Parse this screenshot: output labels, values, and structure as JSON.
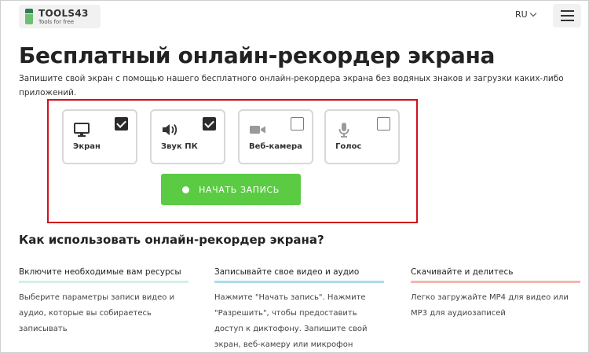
{
  "header": {
    "logo_name": "TOOLS43",
    "logo_tagline": "Tools for free",
    "language": "RU"
  },
  "main": {
    "title": "Бесплатный онлайн-рекордер экрана",
    "subtitle": "Запишите свой экран с помощью нашего бесплатного онлайн-рекордера экрана без водяных знаков и загрузки каких-либо приложений."
  },
  "recorder": {
    "options": [
      {
        "label": "Экран",
        "icon": "monitor-icon",
        "checked": true
      },
      {
        "label": "Звук ПК",
        "icon": "speaker-icon",
        "checked": true
      },
      {
        "label": "Веб-камера",
        "icon": "camera-icon",
        "checked": false
      },
      {
        "label": "Голос",
        "icon": "microphone-icon",
        "checked": false
      }
    ],
    "start_label": "НАЧАТЬ ЗАПИСЬ"
  },
  "howto": {
    "heading": "Как использовать онлайн-рекордер экрана?",
    "steps": [
      {
        "title": "Включите необходимые вам ресурсы",
        "text": "Выберите параметры записи видео и аудио, которые вы собираетесь записывать",
        "accent": "#d3f0e2"
      },
      {
        "title": "Записывайте свое видео и аудио",
        "text": "Нажмите \"Начать запись\". Нажмите \"Разрешить\", чтобы предоставить доступ к диктофону. Запишите свой экран, веб-камеру или микрофон",
        "accent": "#a9dde7"
      },
      {
        "title": "Скачивайте и делитесь",
        "text": "Легко загружайте MP4 для видео или MP3 для аудиозаписей",
        "accent": "#f2b7ae"
      }
    ]
  },
  "colors": {
    "brand_green": "#5bcb44",
    "highlight_red": "#d0111b"
  }
}
